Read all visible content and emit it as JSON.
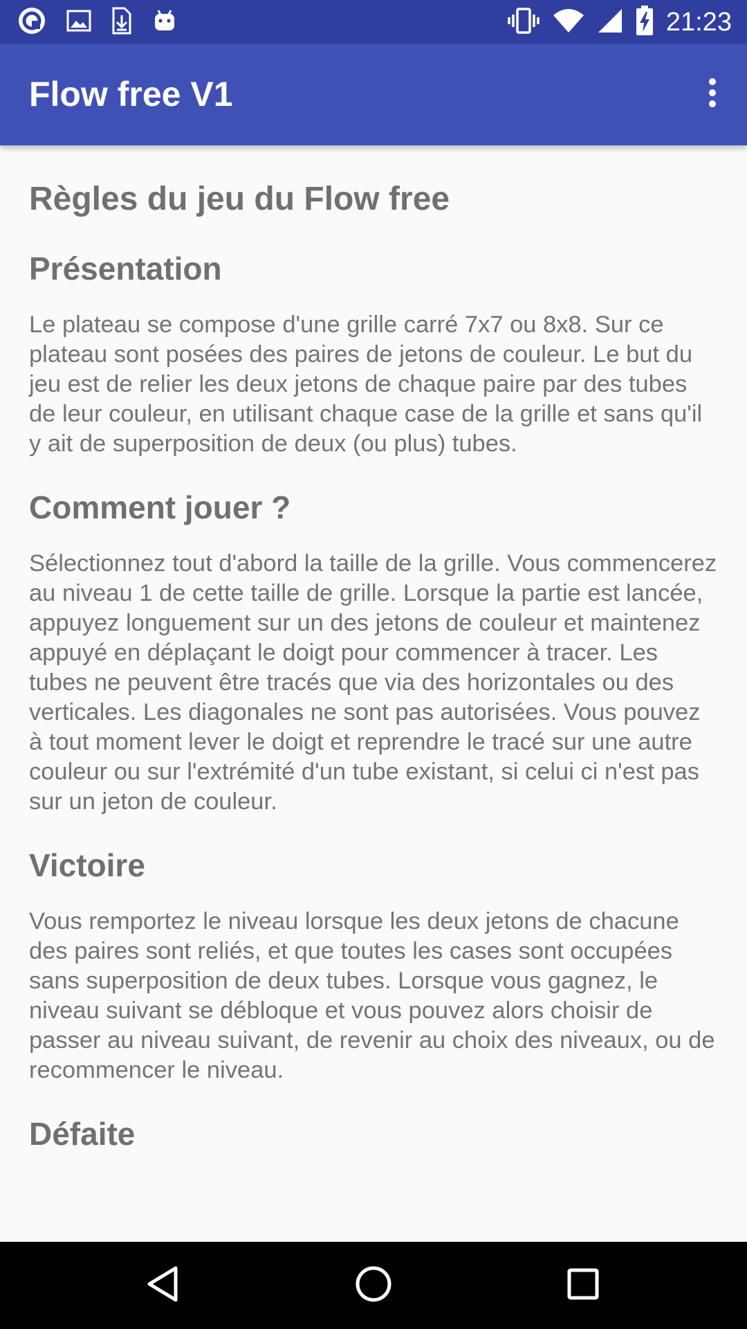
{
  "status_bar": {
    "time": "21:23",
    "left_icons": [
      "sync-icon",
      "image-icon",
      "download-icon",
      "android-icon"
    ],
    "right_icons": [
      "vibrate-icon",
      "wifi-icon",
      "signal-icon",
      "battery-charging-icon"
    ]
  },
  "app_bar": {
    "title": "Flow free V1",
    "overflow_icon": "more-vert-icon"
  },
  "content": {
    "title": "Règles du jeu du Flow free",
    "sections": [
      {
        "heading": "Présentation",
        "body": "Le plateau se compose d'une grille carré 7x7 ou 8x8. Sur ce plateau sont posées des paires de jetons de couleur. Le but du jeu est de relier les deux jetons de chaque paire par des tubes de leur couleur, en utilisant chaque case de la grille et sans qu'il y ait de superposition de deux (ou plus) tubes."
      },
      {
        "heading": "Comment jouer ?",
        "body": "Sélectionnez tout d'abord la taille de la grille. Vous commencerez au niveau 1 de cette taille de grille. Lorsque la partie est lancée, appuyez longuement sur un des jetons de couleur et maintenez appuyé en déplaçant le doigt pour commencer à tracer. Les tubes ne peuvent être tracés que via des horizontales ou des verticales. Les diagonales ne sont pas autorisées. Vous pouvez à tout moment lever le doigt et reprendre le tracé sur une autre couleur ou sur l'extrémité d'un tube existant, si celui ci n'est pas sur un jeton de couleur."
      },
      {
        "heading": "Victoire",
        "body": "Vous remportez le niveau lorsque les deux jetons de chacune des paires sont reliés, et que toutes les cases sont occupées sans superposition de deux tubes. Lorsque vous gagnez, le niveau suivant se débloque et vous pouvez alors choisir de passer au niveau suivant, de revenir au choix des niveaux, ou de recommencer le niveau."
      },
      {
        "heading": "Défaite"
      }
    ]
  },
  "nav_bar": {
    "buttons": [
      "back-icon",
      "home-icon",
      "recents-icon"
    ]
  },
  "colors": {
    "status_bar": "#303f9f",
    "app_bar": "#3f51b5",
    "background": "#fafafa",
    "text": "#747474",
    "nav_bar": "#000000"
  }
}
